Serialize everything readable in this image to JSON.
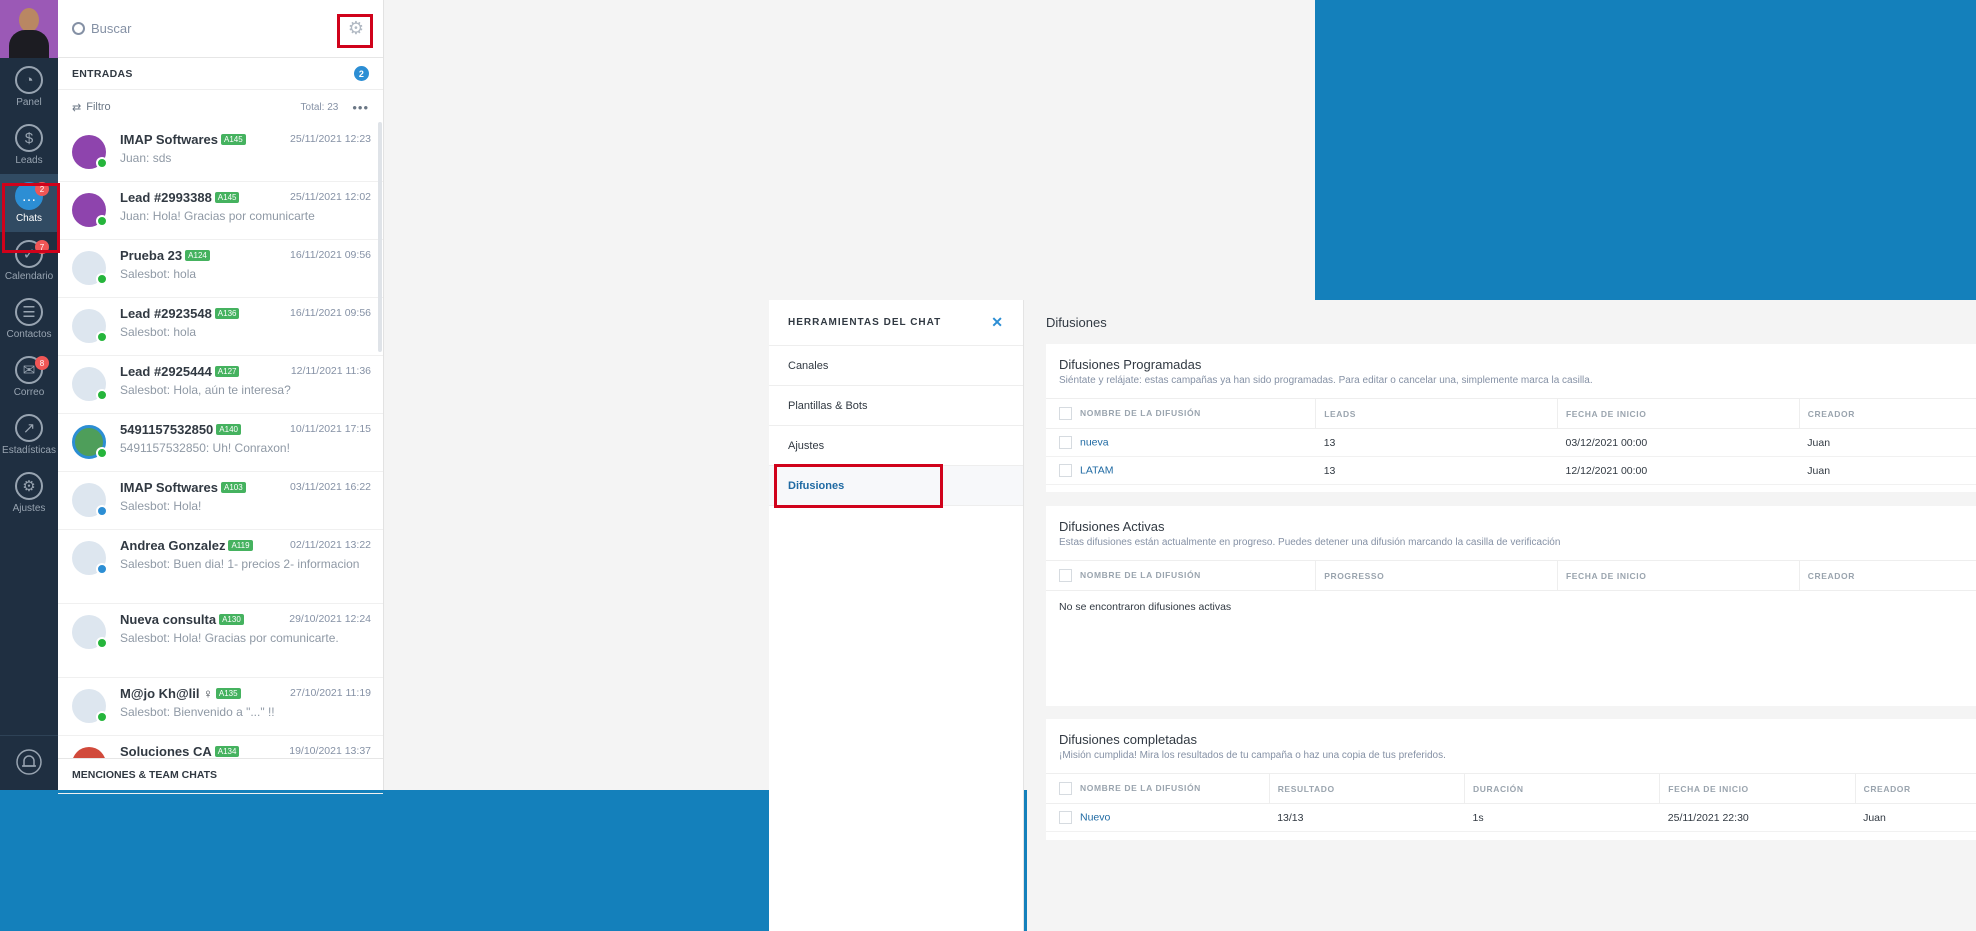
{
  "rail": {
    "items": [
      {
        "label": "Panel",
        "icon": "dashboard-icon",
        "glyph": "◔",
        "badge": ""
      },
      {
        "label": "Leads",
        "icon": "dollar-icon",
        "glyph": "$",
        "badge": ""
      },
      {
        "label": "Chats",
        "icon": "chat-icon",
        "glyph": "…",
        "badge": "2"
      },
      {
        "label": "Calendario",
        "icon": "check-icon",
        "glyph": "✓",
        "badge": "7"
      },
      {
        "label": "Contactos",
        "icon": "contacts-icon",
        "glyph": "☰",
        "badge": ""
      },
      {
        "label": "Correo",
        "icon": "mail-icon",
        "glyph": "✉",
        "badge": "8"
      },
      {
        "label": "Estadísticas",
        "icon": "stats-icon",
        "glyph": "↗",
        "badge": ""
      },
      {
        "label": "Ajustes",
        "icon": "settings-wrench-icon",
        "glyph": "⚙",
        "badge": ""
      }
    ]
  },
  "chatlist": {
    "search_placeholder": "Buscar",
    "section_title": "ENTRADAS",
    "section_count": "2",
    "filter_label": "Filtro",
    "total_label": "Total: 23",
    "more": "•••",
    "footer": "MENCIONES & TEAM CHATS",
    "items": [
      {
        "name": "IMAP Softwares",
        "tag": "A145",
        "time": "25/11/2021 12:23",
        "msg": "Juan: sds"
      },
      {
        "name": "Lead #2993388",
        "tag": "A145",
        "time": "25/11/2021 12:02",
        "msg": "Juan: Hola! Gracias por comunicarte"
      },
      {
        "name": "Prueba 23",
        "tag": "A124",
        "time": "16/11/2021 09:56",
        "msg": "Salesbot: hola"
      },
      {
        "name": "Lead #2923548",
        "tag": "A136",
        "time": "16/11/2021 09:56",
        "msg": "Salesbot: hola"
      },
      {
        "name": "Lead #2925444",
        "tag": "A127",
        "time": "12/11/2021 11:36",
        "msg": "Salesbot: Hola, aún te interesa?"
      },
      {
        "name": "5491157532850",
        "tag": "A140",
        "time": "10/11/2021 17:15",
        "msg": "5491157532850: Uh! Conraxon!"
      },
      {
        "name": "IMAP Softwares",
        "tag": "A103",
        "time": "03/11/2021 16:22",
        "msg": "Salesbot: Hola!"
      },
      {
        "name": "Andrea Gonzalez",
        "tag": "A119",
        "time": "02/11/2021 13:22",
        "msg": "Salesbot: Buen dia! 1- precios 2- informacion"
      },
      {
        "name": "Nueva consulta",
        "tag": "A130",
        "time": "29/10/2021 12:24",
        "msg": "Salesbot: Hola! Gracias por comunicarte."
      },
      {
        "name": "M@jo Kh@lil ♀",
        "tag": "A135",
        "time": "27/10/2021 11:19",
        "msg": "Salesbot: Bienvenido a \"...\" !!"
      },
      {
        "name": "Soluciones CA",
        "tag": "A134",
        "time": "19/10/2021 13:37",
        "msg": ""
      }
    ]
  },
  "tools": {
    "title": "HERRAMIENTAS DEL CHAT",
    "close": "✕",
    "items": [
      "Canales",
      "Plantillas & Bots",
      "Ajustes",
      "Difusiones"
    ]
  },
  "difusiones": {
    "title": "Difusiones",
    "programadas": {
      "title": "Difusiones Programadas",
      "subtitle": "Siéntate y relájate: estas campañas ya han sido programadas. Para editar o cancelar una, simplemente marca la casilla.",
      "headers": [
        "NOMBRE DE LA DIFUSIÓN",
        "LEADS",
        "FECHA DE INICIO",
        "CREADOR"
      ],
      "rows": [
        [
          "nueva",
          "13",
          "03/12/2021 00:00",
          "Juan"
        ],
        [
          "LATAM",
          "13",
          "12/12/2021 00:00",
          "Juan"
        ]
      ]
    },
    "activas": {
      "title": "Difusiones Activas",
      "subtitle": "Estas difusiones están actualmente en progreso. Puedes detener una difusión marcando la casilla de verificación",
      "headers": [
        "NOMBRE DE LA DIFUSIÓN",
        "PROGRESSO",
        "FECHA DE INICIO",
        "CREADOR"
      ],
      "empty": "No se encontraron difusiones activas"
    },
    "completadas": {
      "title": "Difusiones completadas",
      "subtitle": "¡Misión cumplida! Mira los resultados de tu campaña o haz una copia de tus preferidos.",
      "headers": [
        "NOMBRE DE LA DIFUSIÓN",
        "RESULTADO",
        "DURACIÓN",
        "FECHA DE INICIO",
        "CREADOR"
      ],
      "rows": [
        [
          "Nuevo",
          "13/13",
          "1s",
          "25/11/2021 22:30",
          "Juan"
        ]
      ]
    }
  }
}
